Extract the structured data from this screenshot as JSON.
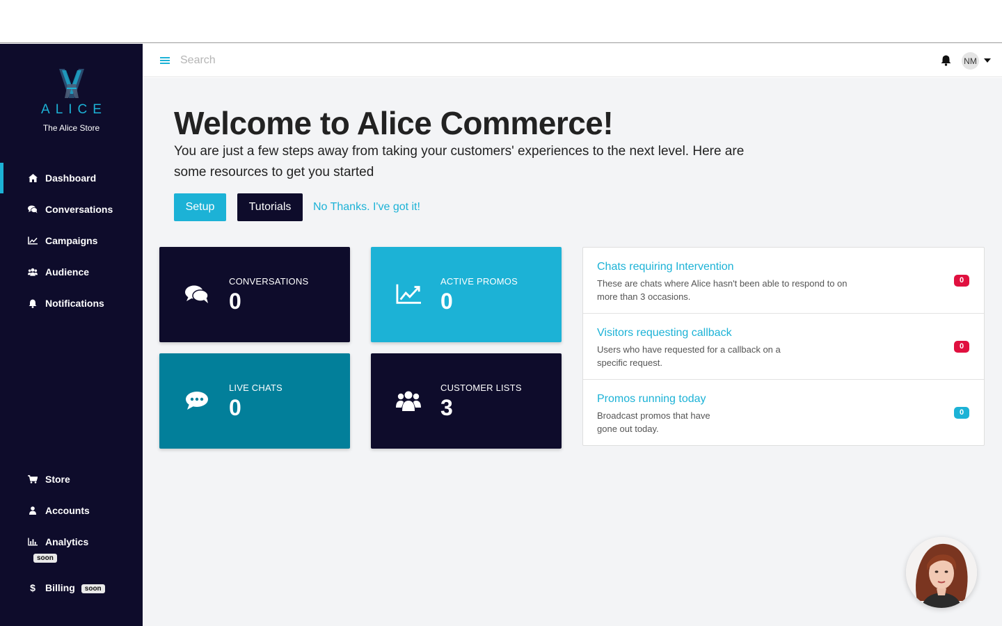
{
  "sidebar": {
    "brand": "ALICE",
    "store_name": "The Alice Store",
    "nav": [
      {
        "label": "Dashboard",
        "icon": "home-icon",
        "active": true
      },
      {
        "label": "Conversations",
        "icon": "comments-icon"
      },
      {
        "label": "Campaigns",
        "icon": "line-chart-icon"
      },
      {
        "label": "Audience",
        "icon": "users-icon"
      },
      {
        "label": "Notifications",
        "icon": "bell-icon"
      }
    ],
    "bottom_nav": [
      {
        "label": "Store",
        "icon": "cart-icon"
      },
      {
        "label": "Accounts",
        "icon": "user-icon"
      },
      {
        "label": "Analytics",
        "icon": "bar-chart-icon",
        "badge": "soon"
      },
      {
        "label": "Billing",
        "icon": "dollar-icon",
        "badge": "soon"
      }
    ]
  },
  "topbar": {
    "search_placeholder": "Search",
    "user_initials": "NM"
  },
  "welcome": {
    "title": "Welcome to Alice Commerce!",
    "subtitle": "You are just a few steps away from taking your customers' experiences to the next level. Here are some resources to get you started",
    "setup_label": "Setup",
    "tutorials_label": "Tutorials",
    "dismiss_label": "No Thanks. I've got it!"
  },
  "cards": [
    {
      "label": "CONVERSATIONS",
      "value": "0",
      "icon": "comments-icon"
    },
    {
      "label": "ACTIVE PROMOS",
      "value": "0",
      "icon": "line-chart-icon"
    },
    {
      "label": "LIVE CHATS",
      "value": "0",
      "icon": "chat-dots-icon"
    },
    {
      "label": "CUSTOMER LISTS",
      "value": "3",
      "icon": "users-icon"
    }
  ],
  "panel": [
    {
      "title": "Chats requiring Intervention",
      "desc": "These are chats where Alice hasn't been able to respond to on more than 3 occasions.",
      "count": "0",
      "badge_color": "#e0103f"
    },
    {
      "title": "Visitors requesting callback",
      "desc": "Users who have requested for a callback on a specific request.",
      "count": "0",
      "badge_color": "#e0103f"
    },
    {
      "title": "Promos running today",
      "desc": "Broadcast promos that have gone out today.",
      "count": "0",
      "badge_color": "#1cb2d6"
    }
  ],
  "colors": {
    "sidebar": "#0e0c2b",
    "accent": "#1cb2d6",
    "teal": "#027f9a",
    "alert": "#e0103f",
    "background": "#f3f4f6"
  }
}
